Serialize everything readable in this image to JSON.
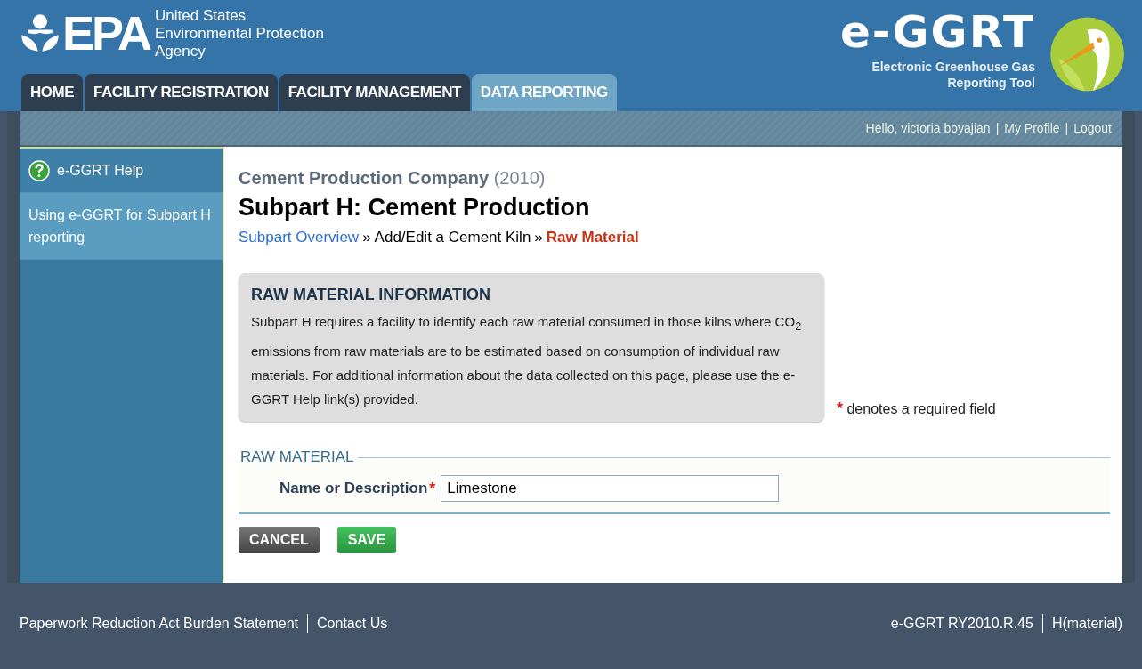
{
  "header": {
    "agency_logo": {
      "mark": "EPA",
      "lines": [
        "United States",
        "Environmental Protection",
        "Agency"
      ]
    },
    "tool_logo": {
      "name": "e-GGRT",
      "tagline": [
        "Electronic Greenhouse Gas",
        "Reporting Tool"
      ]
    }
  },
  "tabs": [
    {
      "label": "HOME",
      "selected": false
    },
    {
      "label": "FACILITY REGISTRATION",
      "selected": false
    },
    {
      "label": "FACILITY MANAGEMENT",
      "selected": false
    },
    {
      "label": "DATA REPORTING",
      "selected": true
    }
  ],
  "user_bar": {
    "greeting": "Hello, victoria boyajian",
    "links": [
      "My Profile",
      "Logout"
    ],
    "separator": "|"
  },
  "sidebar": {
    "items": [
      {
        "kind": "help",
        "label": "e-GGRT Help",
        "selected": false
      },
      {
        "kind": "link",
        "label": "Using e-GGRT for Subpart H reporting",
        "selected": true
      }
    ]
  },
  "page": {
    "company": "Cement Production Company",
    "year": "(2010)",
    "title": "Subpart H: Cement Production",
    "breadcrumb": [
      {
        "label": "Subpart Overview",
        "kind": "link"
      },
      {
        "label": "»",
        "kind": "separator"
      },
      {
        "label": "Add/Edit a Cement Kiln",
        "kind": "text"
      },
      {
        "label": "»",
        "kind": "separator"
      },
      {
        "label": "Raw Material",
        "kind": "current"
      }
    ],
    "info_box": {
      "title": "RAW MATERIAL INFORMATION",
      "text": "Subpart H requires a facility to identify each raw material consumed in those kilns where CO$_{2}$ emissions from raw materials are to be estimated based on consumption of individual raw materials. For additional information about the data collected on this page, please use the e-GGRT Help link(s) provided."
    },
    "required_note": {
      "mark": "*",
      "text": "denotes a required field"
    },
    "section": {
      "legend": "RAW MATERIAL",
      "fields": [
        {
          "label": "Name or Description",
          "required": true,
          "value": "Limestone"
        }
      ]
    },
    "buttons": [
      {
        "label": "CANCEL",
        "kind": "cancel"
      },
      {
        "label": "SAVE",
        "kind": "save"
      }
    ]
  },
  "footer": {
    "left": [
      "Paperwork Reduction Act Burden Statement",
      "Contact Us"
    ],
    "right": [
      "e-GGRT RY2010.R.45",
      "H(material)"
    ]
  }
}
